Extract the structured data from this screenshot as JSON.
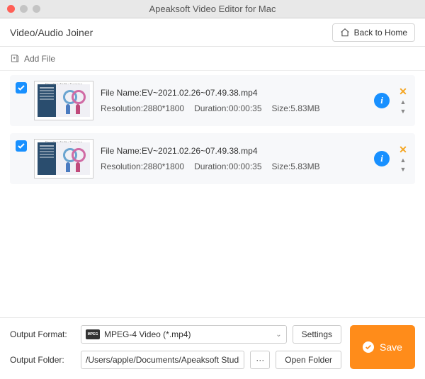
{
  "window": {
    "title": "Apeaksoft Video Editor for Mac"
  },
  "header": {
    "page_title": "Video/Audio Joiner",
    "home_label": "Back to Home"
  },
  "toolbar": {
    "add_file_label": "Add File"
  },
  "field_labels": {
    "file_name_prefix": "File Name:",
    "resolution_prefix": "Resolution:",
    "duration_prefix": "Duration:",
    "size_prefix": "Size:"
  },
  "files": [
    {
      "checked": true,
      "name": "EV~2021.02.26~07.49.38.mp4",
      "resolution": "2880*1800",
      "duration": "00:00:35",
      "size": "5.83MB"
    },
    {
      "checked": true,
      "name": "EV~2021.02.26~07.49.38.mp4",
      "resolution": "2880*1800",
      "duration": "00:00:35",
      "size": "5.83MB"
    }
  ],
  "footer": {
    "output_format_label": "Output Format:",
    "output_format_value": "MPEG-4 Video (*.mp4)",
    "format_badge": "MPEG",
    "settings_label": "Settings",
    "output_folder_label": "Output Folder:",
    "output_folder_value": "/Users/apple/Documents/Apeaksoft Studio/Video",
    "browse_label": "···",
    "open_folder_label": "Open Folder",
    "save_label": "Save"
  }
}
